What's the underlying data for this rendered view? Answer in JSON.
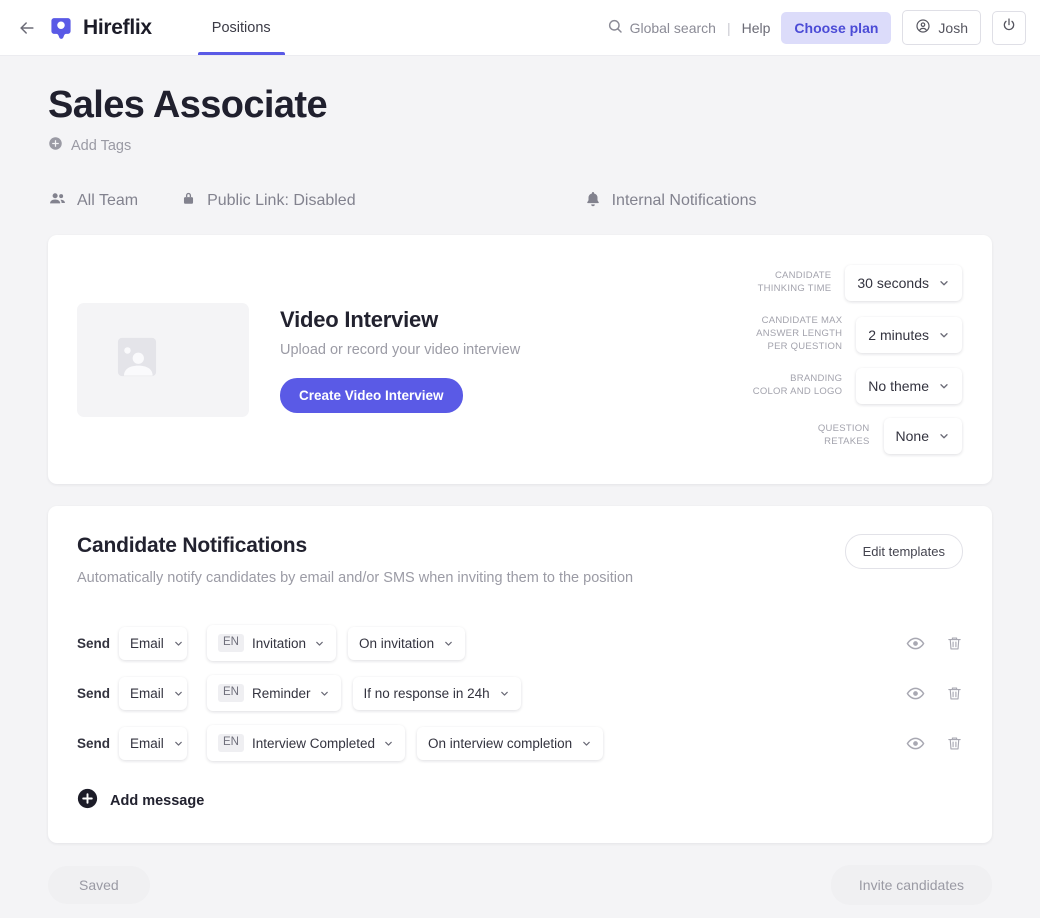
{
  "topbar": {
    "back_icon": "arrow-left-icon",
    "brand_name": "Hireflix",
    "brand_logo_color": "#5a5ae6",
    "tabs": [
      {
        "label": "Positions",
        "active": true
      }
    ],
    "global_search_label": "Global search",
    "divider": "|",
    "help_label": "Help",
    "choose_plan_label": "Choose plan",
    "choose_plan_bg": "#dcdcfa",
    "choose_plan_fg": "#4b4bd6",
    "user_name": "Josh",
    "power_icon": "power-icon"
  },
  "position": {
    "title": "Sales Associate",
    "add_tags_label": "Add Tags",
    "team_label": "All Team",
    "public_link_label": "Public Link: Disabled",
    "internal_notifications_label": "Internal Notifications"
  },
  "video_card": {
    "title": "Video Interview",
    "subtitle": "Upload or record your video interview",
    "cta_label": "Create Video Interview",
    "cta_color": "#5a5ae6",
    "thumbnail_icon": "image-placeholder-icon",
    "settings": [
      {
        "label": "CANDIDATE\nTHINKING TIME",
        "value": "30 seconds"
      },
      {
        "label": "CANDIDATE MAX\nANSWER LENGTH\nPER QUESTION",
        "value": "2 minutes"
      },
      {
        "label": "BRANDING\nCOLOR AND LOGO",
        "value": "No theme"
      },
      {
        "label": "QUESTION\nRETAKES",
        "value": "None"
      }
    ]
  },
  "notifications_card": {
    "title": "Candidate Notifications",
    "subtitle": "Automatically notify candidates by email and/or SMS when inviting them to the position",
    "edit_templates_label": "Edit templates",
    "send_label": "Send",
    "rows": [
      {
        "channel": "Email",
        "language": "EN",
        "template": "Invitation",
        "trigger": "On invitation"
      },
      {
        "channel": "Email",
        "language": "EN",
        "template": "Reminder",
        "trigger": "If no response in 24h"
      },
      {
        "channel": "Email",
        "language": "EN",
        "template": "Interview Completed",
        "trigger": "On interview completion"
      }
    ],
    "add_message_label": "Add message"
  },
  "footer": {
    "saved_label": "Saved",
    "invite_label": "Invite candidates"
  }
}
